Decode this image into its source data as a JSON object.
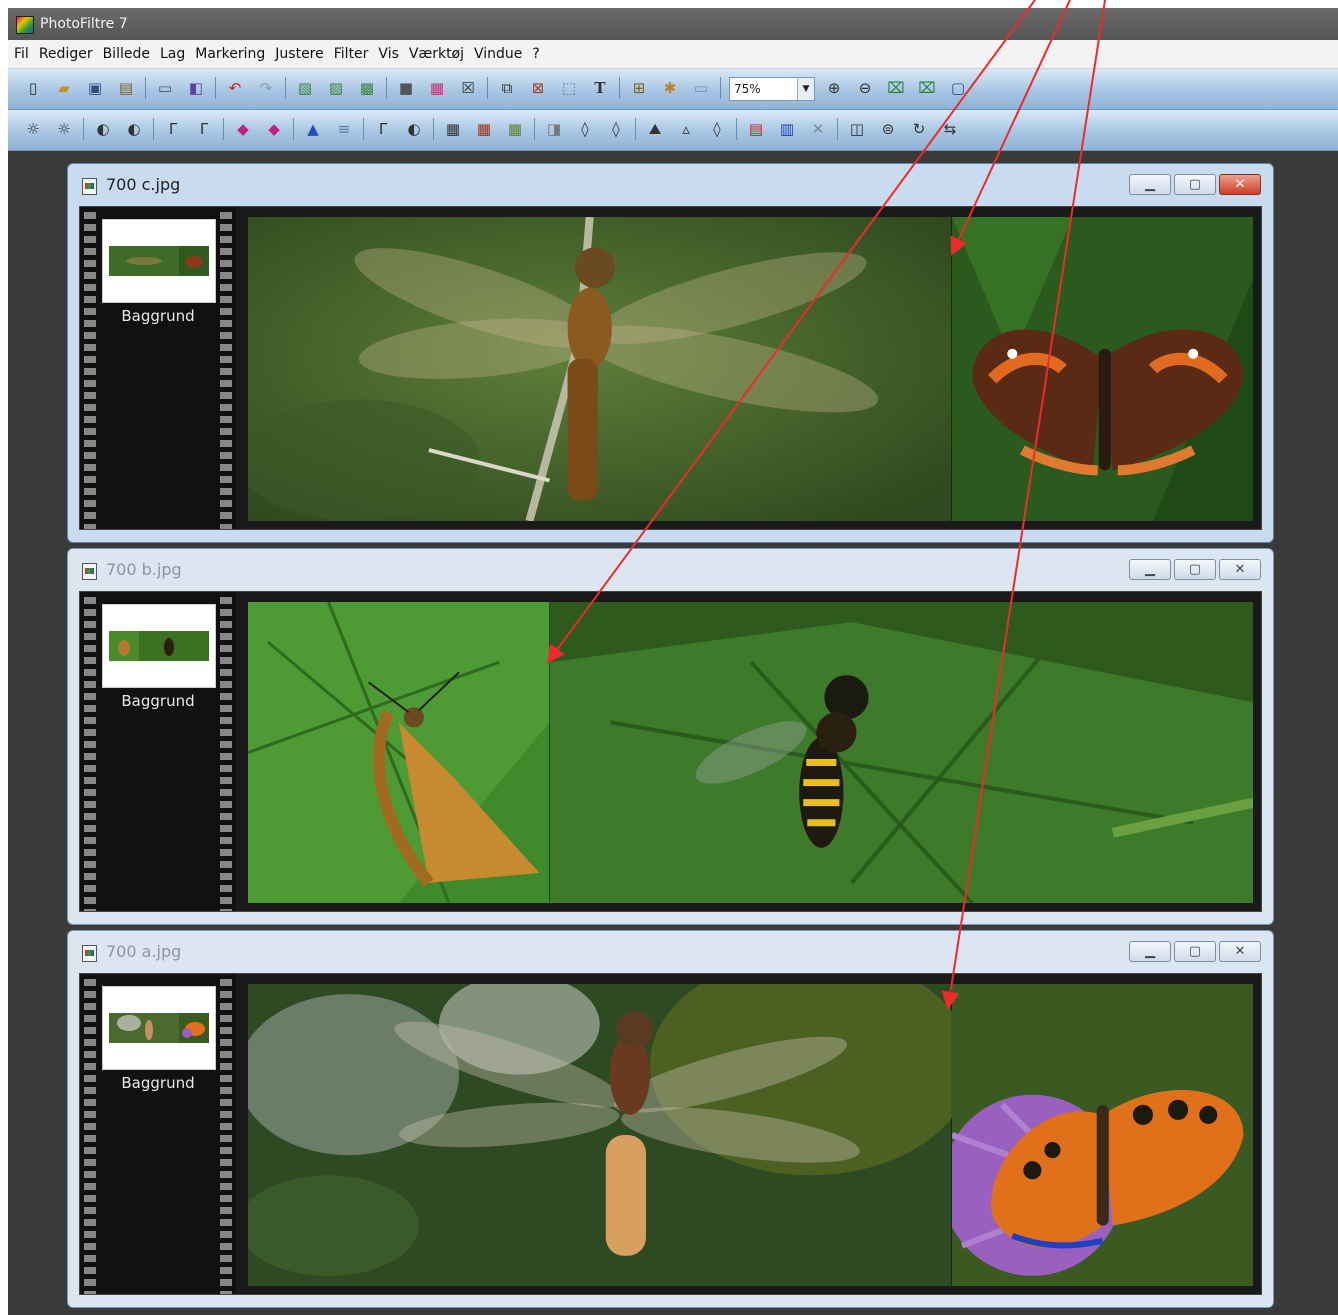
{
  "app": {
    "title": "PhotoFiltre 7"
  },
  "menu": [
    "Fil",
    "Rediger",
    "Billede",
    "Lag",
    "Markering",
    "Justere",
    "Filter",
    "Vis",
    "Værktøj",
    "Vindue",
    "?"
  ],
  "toolbar": {
    "zoom_value": "75%"
  },
  "windows": [
    {
      "title": "700 c.jpg",
      "layer_name": "Baggrund",
      "state": "active"
    },
    {
      "title": "700 b.jpg",
      "layer_name": "Baggrund",
      "state": "inactive"
    },
    {
      "title": "700 a.jpg",
      "layer_name": "Baggrund",
      "state": "inactive"
    }
  ],
  "colors": {
    "annotation_arrow": "#ee2a2a",
    "workspace_bg": "#3a3a3a",
    "toolbar_blue": "#a7c6e3"
  },
  "icons": {
    "toolbar1": [
      "new-file-icon",
      "open-file-icon",
      "save-icon",
      "paste-icon",
      "print-icon",
      "scan-icon",
      "undo-icon",
      "redo-icon",
      "copy-image-icon",
      "paste-image-icon",
      "duplicate-icon",
      "grayscale-icon",
      "rgb-icon",
      "filter-icon",
      "crop-icon",
      "resize-icon",
      "select-icon",
      "text-icon",
      "layer-icon",
      "effects-icon",
      "window-icon",
      "zoom-in-icon",
      "zoom-out-icon",
      "fit-icon",
      "actual-size-icon",
      "fullscreen-icon"
    ],
    "toolbar2": [
      "brightness-minus-icon",
      "brightness-plus-icon",
      "contrast-minus-icon",
      "contrast-plus-icon",
      "gamma-minus-icon",
      "gamma-plus-icon",
      "saturation-minus-icon",
      "saturation-plus-icon",
      "histogram-icon",
      "levels-icon",
      "auto-contrast-icon",
      "auto-level-icon",
      "blur-icon",
      "sharpen-icon",
      "noise-icon",
      "fade-icon",
      "drop-icon",
      "drop-plus-icon",
      "landscape-icon",
      "soften-icon",
      "sharpen-more-icon",
      "gradient-icon",
      "color-balance-icon",
      "mask-icon",
      "frame-icon",
      "align-icon",
      "rotate-icon",
      "flip-icon"
    ]
  }
}
